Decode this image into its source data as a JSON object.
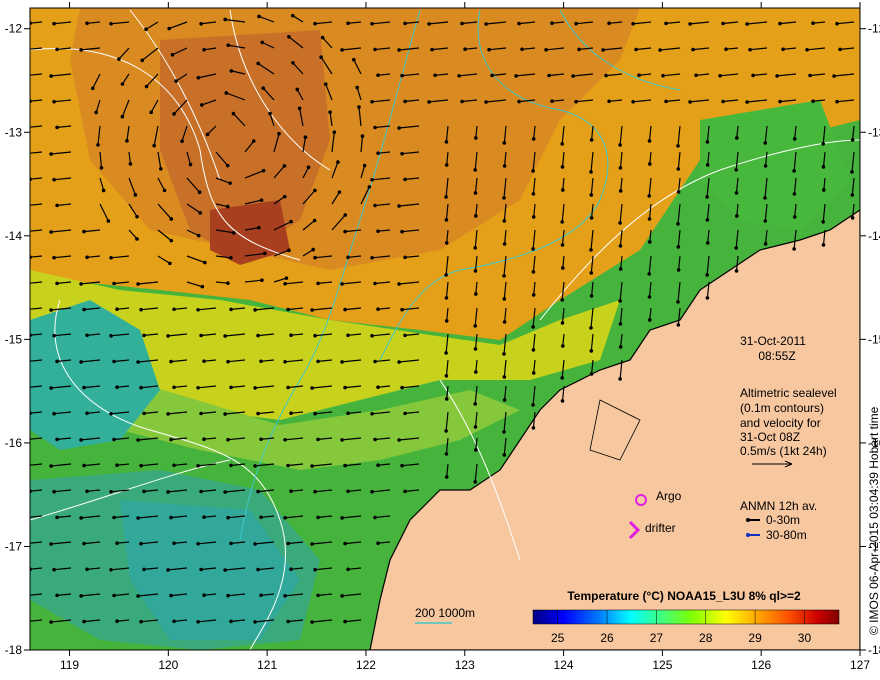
{
  "map": {
    "lon_ticks": [
      "119",
      "120",
      "121",
      "122",
      "123",
      "124",
      "125",
      "126",
      "127"
    ],
    "lat_ticks": [
      "-12",
      "-13",
      "-14",
      "-15",
      "-16",
      "-17",
      "-18"
    ],
    "lon_range": [
      118.6,
      127.0
    ],
    "lat_range": [
      -18.0,
      -11.8
    ]
  },
  "annotations": {
    "date": "31-Oct-2011",
    "time": "08:55Z",
    "altimetry_lines": [
      "Altimetric sealevel",
      "(0.1m contours)",
      "and velocity for",
      "31-Oct 08Z",
      "0.5m/s (1kt 24h)"
    ],
    "argo_label": "Argo",
    "drifter_label": "drifter",
    "anmn_title": "ANMN 12h av.",
    "anmn_shallow": "0-30m",
    "anmn_deep": "30-80m",
    "bathymetry_label": "200  1000m",
    "credit": "© IMOS 06-Apr-2015 03:04:39 Hobart time"
  },
  "colorbar": {
    "title": "Temperature (°C) NOAA15_L3U 8% ql>=2",
    "ticks": [
      "25",
      "26",
      "27",
      "28",
      "29",
      "30"
    ],
    "range": [
      24.5,
      30.7
    ],
    "stops": [
      "#00007f",
      "#0000ff",
      "#0080ff",
      "#00ffff",
      "#40ff80",
      "#80ff00",
      "#ffff00",
      "#ffaa00",
      "#ff5500",
      "#cc0000",
      "#7f0000"
    ]
  },
  "colors": {
    "land": "#f7c7a0",
    "coastline": "#000000",
    "contour": "#ffffff",
    "bathymetry": "#40c8c8",
    "argo": "#e020e0",
    "drifter": "#e020e0",
    "anmn_shallow": "#000000",
    "anmn_deep": "#1030c0"
  }
}
